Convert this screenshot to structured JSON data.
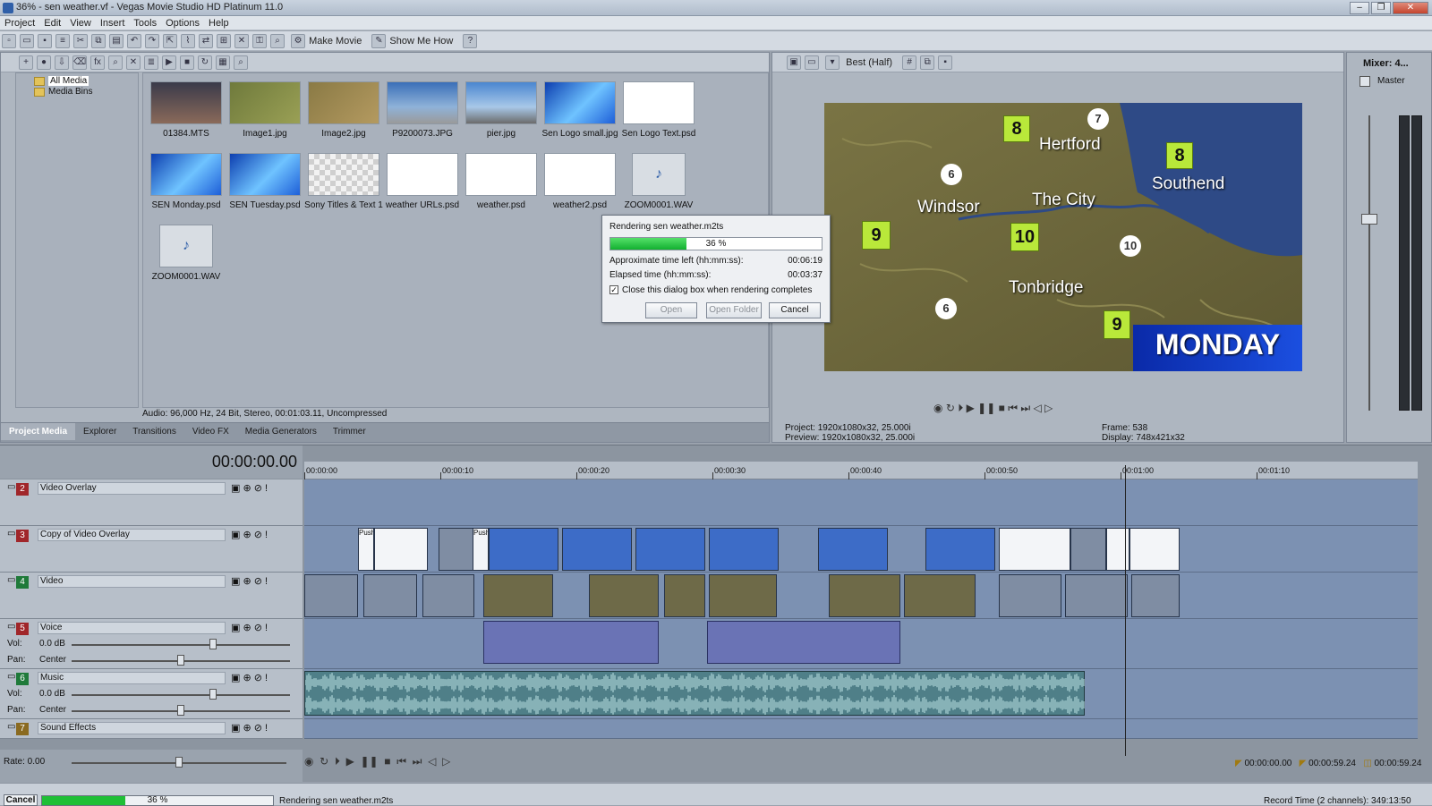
{
  "window": {
    "title": "36% - sen weather.vf - Vegas Movie Studio HD Platinum 11.0"
  },
  "menu": [
    "Project",
    "Edit",
    "View",
    "Insert",
    "Tools",
    "Options",
    "Help"
  ],
  "toolbar": {
    "make_movie": "Make Movie",
    "show_me_how": "Show Me How"
  },
  "tree": {
    "root": "All Media",
    "child": "Media Bins"
  },
  "media_items": [
    {
      "label": "01384.MTS",
      "kind": "news"
    },
    {
      "label": "Image1.jpg",
      "kind": "map"
    },
    {
      "label": "Image2.jpg",
      "kind": "map2"
    },
    {
      "label": "P9200073.JPG",
      "kind": "sky"
    },
    {
      "label": "pier.jpg",
      "kind": "pier"
    },
    {
      "label": "Sen Logo small.jpg",
      "kind": "blue"
    },
    {
      "label": "Sen Logo Text.psd",
      "kind": "sen"
    },
    {
      "label": "SEN Monday.psd",
      "kind": "blue"
    },
    {
      "label": "SEN Tuesday.psd",
      "kind": "blue"
    },
    {
      "label": "Sony Titles & Text 1",
      "kind": "checker"
    },
    {
      "label": "weather URLs.psd",
      "kind": "white"
    },
    {
      "label": "weather.psd",
      "kind": "white"
    },
    {
      "label": "weather2.psd",
      "kind": "white"
    },
    {
      "label": "ZOOM0001.WAV",
      "kind": "wav"
    },
    {
      "label": "ZOOM0001.WAV",
      "kind": "wav"
    }
  ],
  "media_status": "Audio: 96,000 Hz, 24 Bit, Stereo, 00:01:03.11, Uncompressed",
  "media_tabs": [
    "Project Media",
    "Explorer",
    "Transitions",
    "Video FX",
    "Media Generators",
    "Trimmer"
  ],
  "preview": {
    "quality": "Best (Half)",
    "project_label": "Project:",
    "project_value": "1920x1080x32, 25.000i",
    "preview_label": "Preview:",
    "preview_value": "1920x1080x32, 25.000i",
    "frame_label": "Frame:",
    "frame_value": "538",
    "display_label": "Display:",
    "display_value": "748x421x32",
    "map_places": [
      "Hertford",
      "Windsor",
      "The City",
      "Southend",
      "Tonbridge"
    ],
    "map_temps": [
      "8",
      "8",
      "9",
      "10",
      "9"
    ],
    "map_wind": [
      "7",
      "6",
      "10",
      "6"
    ],
    "banner": "MONDAY"
  },
  "mixer": {
    "title": "Mixer: 4...",
    "master": "Master"
  },
  "dialog": {
    "title": "Rendering sen weather.m2ts",
    "progress": 36,
    "progress_text": "36 %",
    "time_left_label": "Approximate time left (hh:mm:ss):",
    "time_left": "00:06:19",
    "elapsed_label": "Elapsed time (hh:mm:ss):",
    "elapsed": "00:03:37",
    "close_label": "Close this dialog box when rendering completes",
    "open": "Open",
    "open_folder": "Open Folder",
    "cancel": "Cancel"
  },
  "timeline": {
    "current_time": "00:00:00.00",
    "ruler": [
      "00:00:00",
      "00:00:10",
      "00:00:20",
      "00:00:30",
      "00:00:40",
      "00:00:50",
      "00:01:00",
      "00:01:10"
    ],
    "rate": "Rate: 0.00",
    "tracks": [
      {
        "num": "2",
        "name": "Video Overlay",
        "color": "#a0262a"
      },
      {
        "num": "3",
        "name": "Copy of Video Overlay",
        "color": "#a0262a"
      },
      {
        "num": "4",
        "name": "Video",
        "color": "#1f7a3a"
      },
      {
        "num": "5",
        "name": "Voice",
        "color": "#a0262a"
      },
      {
        "num": "6",
        "name": "Music",
        "color": "#1f7a3a"
      },
      {
        "num": "7",
        "name": "Sound Effects",
        "color": "#8a6a20"
      }
    ],
    "vol_label": "Vol:",
    "vol_value": "0.0 dB",
    "pan_label": "Pan:",
    "pan_value": "Center",
    "clip_push": "Push",
    "timecode_start": "00:00:00.00",
    "timecode_end": "00:00:59.24",
    "timecode_len": "00:00:59.24"
  },
  "status": {
    "cancel": "Cancel",
    "progress": 36,
    "progress_text": "36 %",
    "message": "Rendering sen weather.m2ts",
    "record_time": "Record Time (2 channels): 349:13:50"
  }
}
